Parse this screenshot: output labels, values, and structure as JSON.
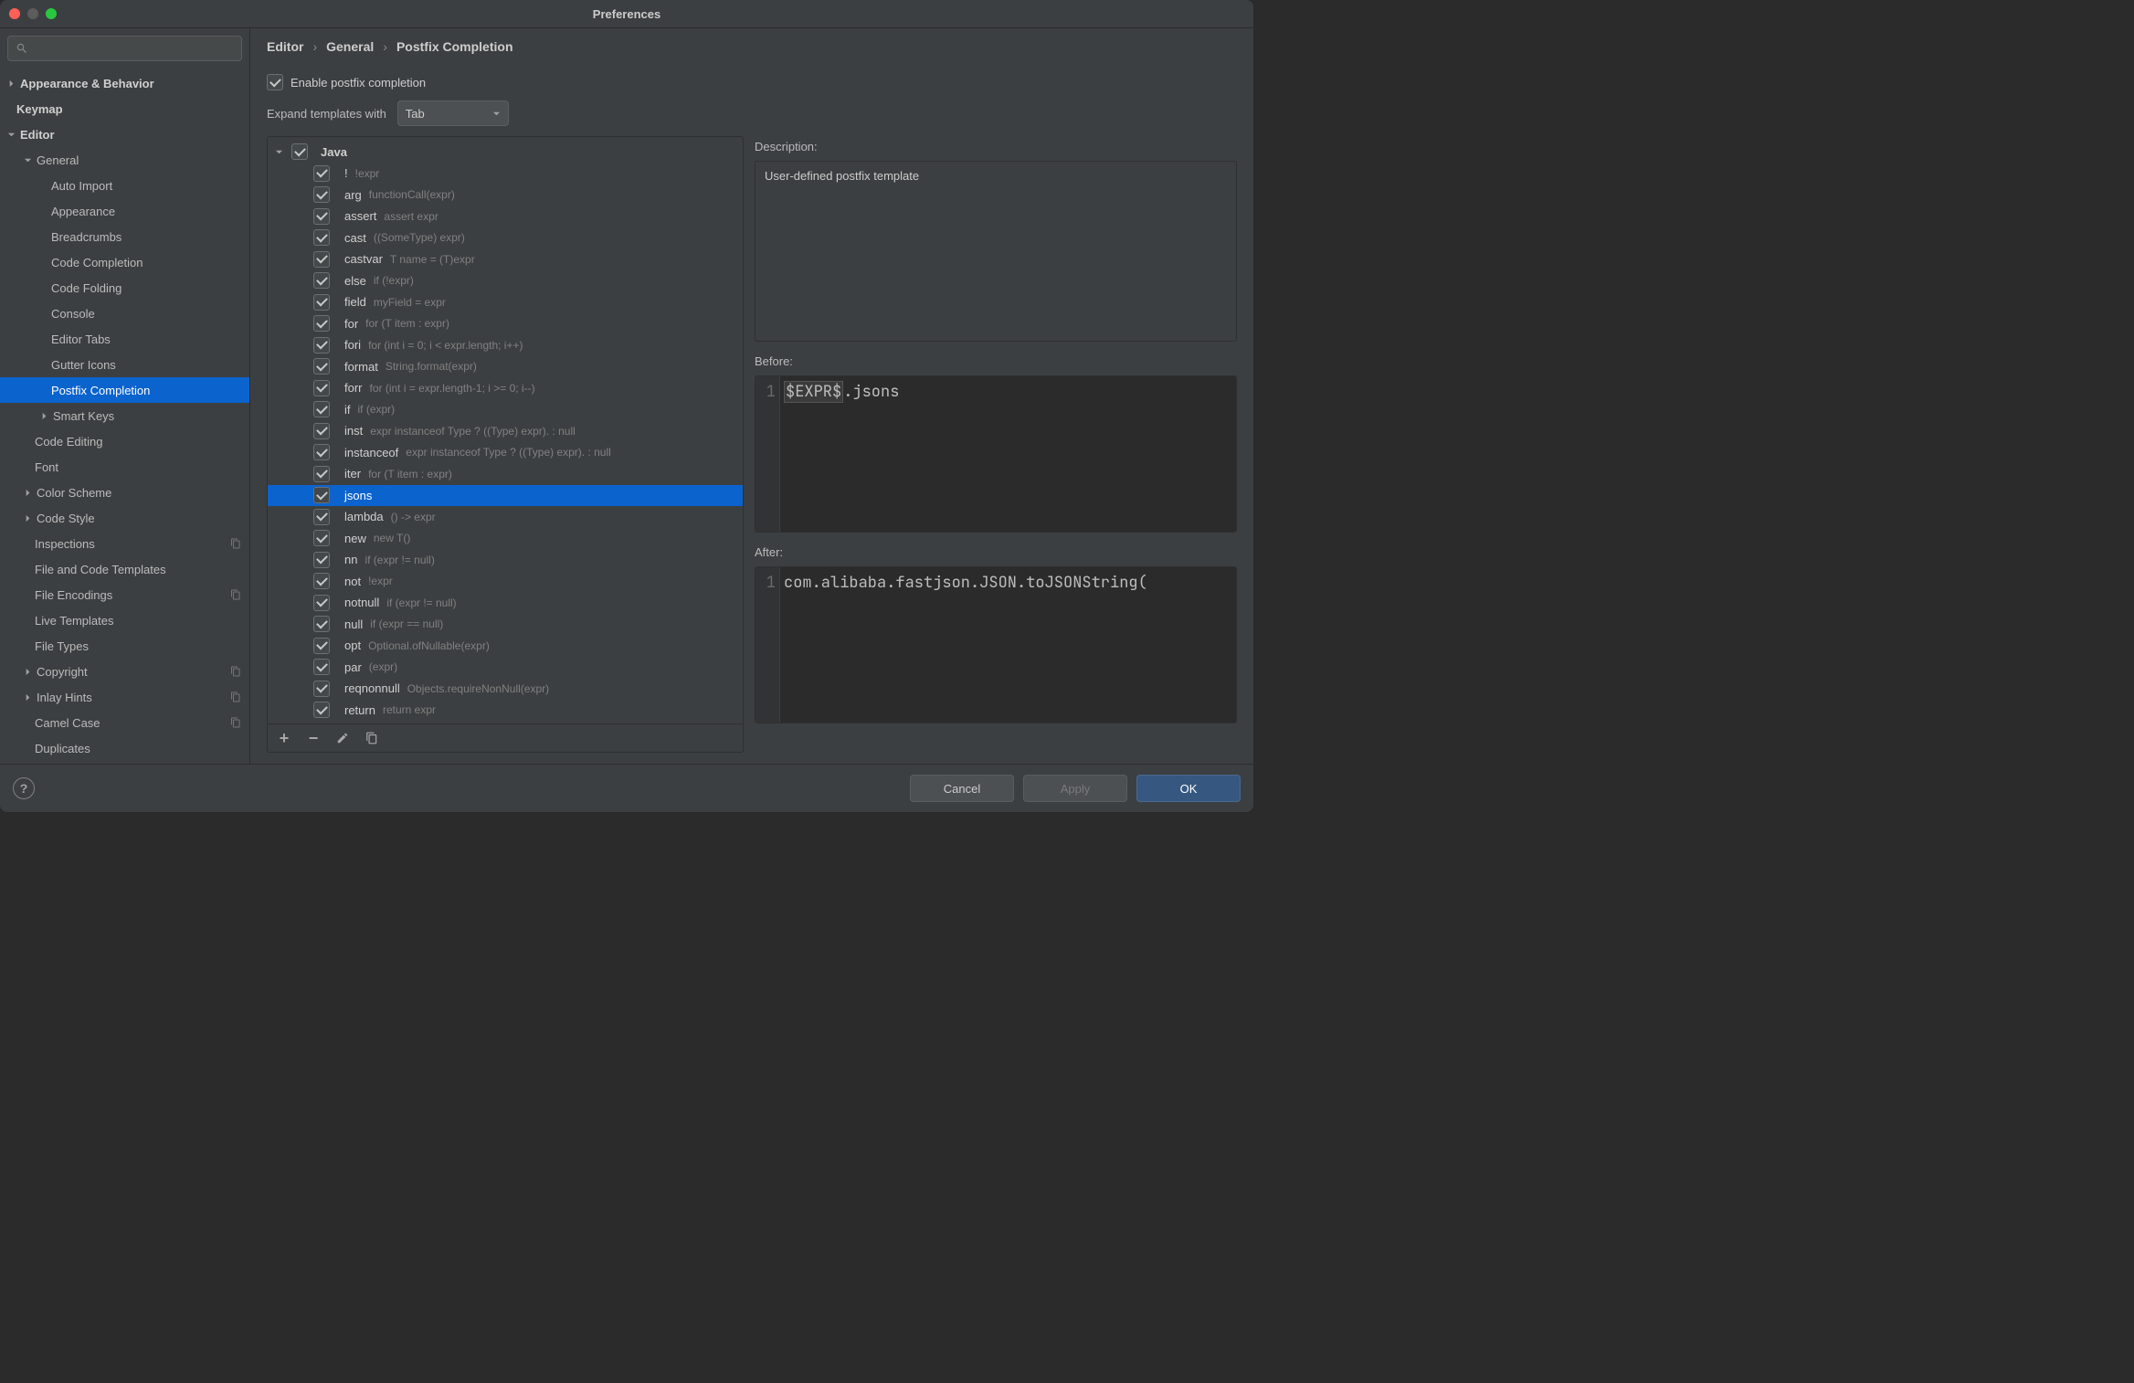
{
  "window": {
    "title": "Preferences"
  },
  "breadcrumbs": [
    "Editor",
    "General",
    "Postfix Completion"
  ],
  "enable": {
    "label": "Enable postfix completion",
    "checked": true
  },
  "expand": {
    "label": "Expand templates with",
    "value": "Tab"
  },
  "sidebar": [
    {
      "label": "Appearance & Behavior",
      "level": 0,
      "bold": true,
      "arrow": "right"
    },
    {
      "label": "Keymap",
      "level": 0,
      "bold": true
    },
    {
      "label": "Editor",
      "level": 0,
      "bold": true,
      "arrow": "down"
    },
    {
      "label": "General",
      "level": 1,
      "arrow": "down"
    },
    {
      "label": "Auto Import",
      "level": 2
    },
    {
      "label": "Appearance",
      "level": 2
    },
    {
      "label": "Breadcrumbs",
      "level": 2
    },
    {
      "label": "Code Completion",
      "level": 2
    },
    {
      "label": "Code Folding",
      "level": 2
    },
    {
      "label": "Console",
      "level": 2
    },
    {
      "label": "Editor Tabs",
      "level": 2
    },
    {
      "label": "Gutter Icons",
      "level": 2
    },
    {
      "label": "Postfix Completion",
      "level": 2,
      "selected": true
    },
    {
      "label": "Smart Keys",
      "level": 2,
      "arrow": "right"
    },
    {
      "label": "Code Editing",
      "level": 1
    },
    {
      "label": "Font",
      "level": 1
    },
    {
      "label": "Color Scheme",
      "level": 1,
      "arrow": "right"
    },
    {
      "label": "Code Style",
      "level": 1,
      "arrow": "right"
    },
    {
      "label": "Inspections",
      "level": 1,
      "dup": true
    },
    {
      "label": "File and Code Templates",
      "level": 1
    },
    {
      "label": "File Encodings",
      "level": 1,
      "dup": true
    },
    {
      "label": "Live Templates",
      "level": 1
    },
    {
      "label": "File Types",
      "level": 1
    },
    {
      "label": "Copyright",
      "level": 1,
      "arrow": "right",
      "dup": true
    },
    {
      "label": "Inlay Hints",
      "level": 1,
      "arrow": "right",
      "dup": true
    },
    {
      "label": "Camel Case",
      "level": 1,
      "dup": true
    },
    {
      "label": "Duplicates",
      "level": 1
    }
  ],
  "templates": {
    "root": "Java",
    "items": [
      {
        "key": "!",
        "desc": "!expr"
      },
      {
        "key": "arg",
        "desc": "functionCall(expr)"
      },
      {
        "key": "assert",
        "desc": "assert expr"
      },
      {
        "key": "cast",
        "desc": "((SomeType) expr)"
      },
      {
        "key": "castvar",
        "desc": "T name = (T)expr"
      },
      {
        "key": "else",
        "desc": "if (!expr)"
      },
      {
        "key": "field",
        "desc": "myField = expr"
      },
      {
        "key": "for",
        "desc": "for (T item : expr)"
      },
      {
        "key": "fori",
        "desc": "for (int i = 0; i < expr.length; i++)"
      },
      {
        "key": "format",
        "desc": "String.format(expr)"
      },
      {
        "key": "forr",
        "desc": "for (int i = expr.length-1; i >= 0; i--)"
      },
      {
        "key": "if",
        "desc": "if (expr)"
      },
      {
        "key": "inst",
        "desc": "expr instanceof Type ? ((Type) expr). : null"
      },
      {
        "key": "instanceof",
        "desc": "expr instanceof Type ? ((Type) expr). : null"
      },
      {
        "key": "iter",
        "desc": "for (T item : expr)"
      },
      {
        "key": "jsons",
        "desc": "",
        "selected": true
      },
      {
        "key": "lambda",
        "desc": "() -> expr"
      },
      {
        "key": "new",
        "desc": "new T()"
      },
      {
        "key": "nn",
        "desc": "if (expr != null)"
      },
      {
        "key": "not",
        "desc": "!expr"
      },
      {
        "key": "notnull",
        "desc": "if (expr != null)"
      },
      {
        "key": "null",
        "desc": "if (expr == null)"
      },
      {
        "key": "opt",
        "desc": "Optional.ofNullable(expr)"
      },
      {
        "key": "par",
        "desc": "(expr)"
      },
      {
        "key": "reqnonnull",
        "desc": "Objects.requireNonNull(expr)"
      },
      {
        "key": "return",
        "desc": "return expr"
      }
    ]
  },
  "detail": {
    "description_title": "Description:",
    "description_text": "User-defined postfix template",
    "before_title": "Before:",
    "before_highlight": "$EXPR$",
    "before_rest": ".jsons",
    "after_title": "After:",
    "after_code": "com.alibaba.fastjson.JSON.toJSONString("
  },
  "footer": {
    "cancel": "Cancel",
    "apply": "Apply",
    "ok": "OK"
  }
}
